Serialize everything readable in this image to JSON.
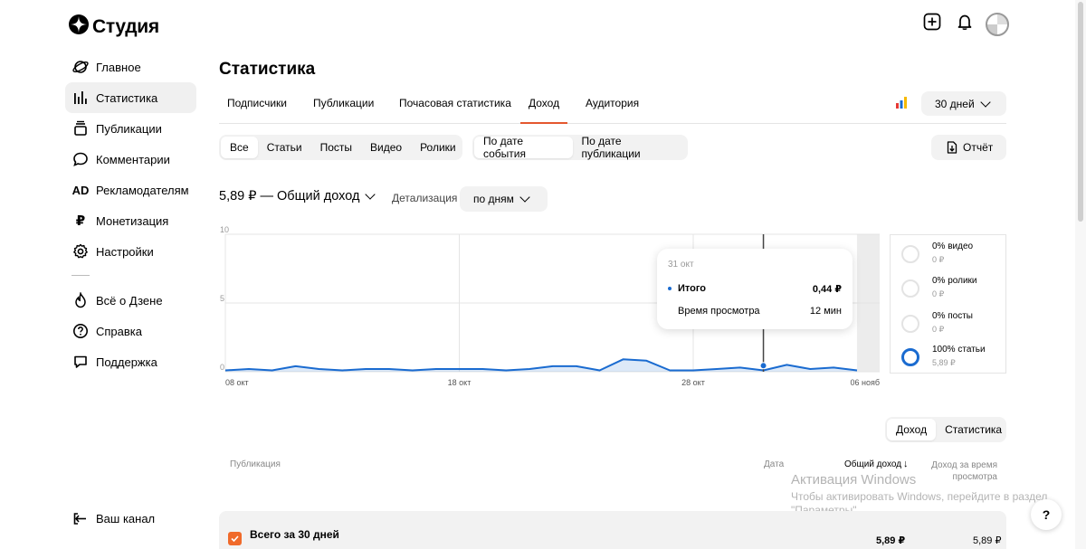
{
  "app": {
    "logo_text": "Студия"
  },
  "sidebar": {
    "items": [
      {
        "label": "Главное",
        "icon": "planet-icon"
      },
      {
        "label": "Статистика",
        "icon": "bar-chart-icon",
        "active": true
      },
      {
        "label": "Публикации",
        "icon": "stack-icon"
      },
      {
        "label": "Комментарии",
        "icon": "speech-bubble-icon"
      },
      {
        "label": "Рекламодателям",
        "icon": "ad-icon",
        "glyph": "AD"
      },
      {
        "label": "Монетизация",
        "icon": "ruble-icon",
        "glyph": "₽"
      },
      {
        "label": "Настройки",
        "icon": "gear-icon"
      }
    ],
    "secondary": [
      {
        "label": "Всё о Дзене",
        "icon": "flame-icon"
      },
      {
        "label": "Справка",
        "icon": "question-icon"
      },
      {
        "label": "Поддержка",
        "icon": "chat-icon"
      }
    ],
    "channel": {
      "label": "Ваш канал",
      "icon": "exit-icon"
    }
  },
  "header": {
    "title": "Статистика"
  },
  "tabs": [
    "Подписчики",
    "Публикации",
    "Почасовая статистика",
    "Доход",
    "Аудитория"
  ],
  "active_tab": "Доход",
  "period": {
    "label": "30 дней"
  },
  "content_filter": {
    "options": [
      "Все",
      "Статьи",
      "Посты",
      "Видео",
      "Ролики"
    ],
    "selected": "Все"
  },
  "date_filter": {
    "options": [
      "По дате события",
      "По дате публикации"
    ],
    "selected": "По дате события"
  },
  "report_button": "Отчёт",
  "summary": {
    "total": "5,89 ₽ — Общий доход",
    "detail_label": "Детализация",
    "detail_value": "по дням"
  },
  "chart_data": {
    "type": "area",
    "y_ticks": [
      "10",
      "5",
      "0"
    ],
    "x_tick_labels": [
      "08 окт",
      "18 окт",
      "28 окт",
      "06 нояб"
    ],
    "ylim": [
      0,
      10
    ],
    "x": [
      "08 окт",
      "09 окт",
      "10 окт",
      "11 окт",
      "12 окт",
      "13 окт",
      "14 окт",
      "15 окт",
      "16 окт",
      "17 окт",
      "18 окт",
      "19 окт",
      "20 окт",
      "21 окт",
      "22 окт",
      "23 окт",
      "24 окт",
      "25 окт",
      "26 окт",
      "27 окт",
      "28 окт",
      "29 окт",
      "30 окт",
      "31 окт",
      "01 нояб",
      "02 нояб",
      "03 нояб",
      "04 нояб"
    ],
    "values": [
      0.1,
      0.2,
      0.1,
      0.4,
      0.2,
      0.1,
      0.2,
      0.2,
      0.1,
      0.2,
      0.2,
      0.2,
      0.1,
      0.2,
      0.4,
      0.4,
      0.1,
      0.9,
      0.8,
      0.1,
      0.1,
      0.2,
      0.3,
      0.1,
      0.5,
      0.2,
      0.3,
      0.1
    ],
    "series_color": "#1a6bd0",
    "highlight": {
      "x": "31 окт",
      "value": 0.44
    },
    "shaded_region": {
      "from": "04 нояб",
      "to": "06 нояб"
    }
  },
  "tooltip": {
    "date": "31 окт",
    "label": "Итого",
    "value": "0,44 ₽",
    "watch_label": "Время просмотра",
    "watch_value": "12 мин"
  },
  "breakdown": [
    {
      "pct": "0%",
      "label": "видео",
      "amount": "0 ₽",
      "fraction": 0
    },
    {
      "pct": "0%",
      "label": "ролики",
      "amount": "0 ₽",
      "fraction": 0
    },
    {
      "pct": "0%",
      "label": "посты",
      "amount": "0 ₽",
      "fraction": 0
    },
    {
      "pct": "100%",
      "label": "статьи",
      "amount": "5,89 ₽",
      "fraction": 1
    }
  ],
  "view_toggle": {
    "options": [
      "Доход",
      "Статистика"
    ],
    "selected": "Доход"
  },
  "table": {
    "headers": {
      "publication": "Публикация",
      "date": "Дата",
      "total": "Общий доход",
      "watch_1": "Доход за время",
      "watch_2": "просмотра"
    },
    "total_row": {
      "label": "Всего за 30 дней",
      "total": "5,89 ₽",
      "watch": "5,89 ₽"
    }
  },
  "watermark": {
    "title": "Активация Windows",
    "line1": "Чтобы активировать Windows, перейдите в раздел",
    "line2": "\"Параметры\"."
  },
  "help_label": "?"
}
